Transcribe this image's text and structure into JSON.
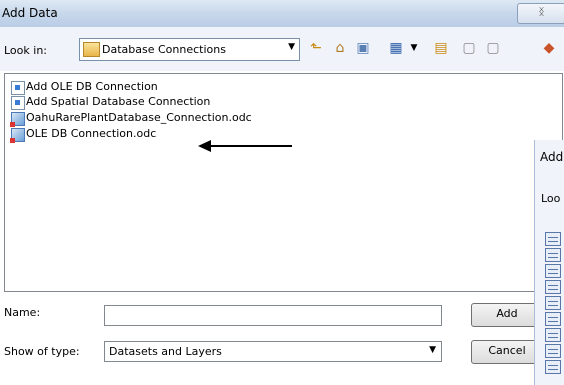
{
  "dialog": {
    "title": "Add Data",
    "close_label": "ᛝ"
  },
  "lookin": {
    "label": "Look in:",
    "value": "Database Connections"
  },
  "files": [
    {
      "label": "Add OLE DB Connection",
      "icon": "add-connection-icon"
    },
    {
      "label": "Add Spatial Database Connection",
      "icon": "add-connection-icon"
    },
    {
      "label": "OahuRarePlantDatabase_Connection.odc",
      "icon": "odc-file-icon"
    },
    {
      "label": "OLE DB Connection.odc",
      "icon": "odc-file-icon"
    }
  ],
  "form": {
    "name_label": "Name:",
    "name_value": "",
    "type_label": "Show of type:",
    "type_value": "Datasets and Layers"
  },
  "buttons": {
    "add": "Add",
    "cancel": "Cancel"
  },
  "second_dialog": {
    "title": "Add",
    "lookin": "Loo"
  },
  "colors": {
    "titlebar": "#c9d9ec",
    "arrow": "#000000"
  }
}
